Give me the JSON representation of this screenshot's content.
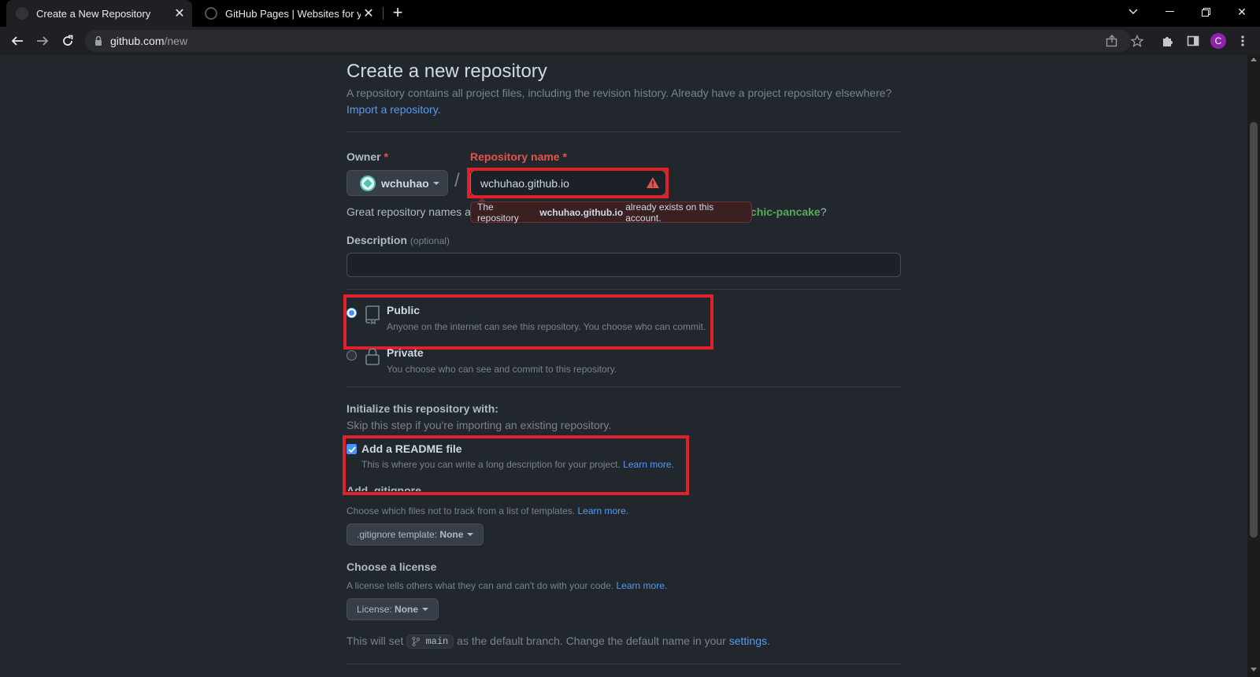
{
  "browser": {
    "tabs": [
      {
        "title": "Create a New Repository",
        "active": true
      },
      {
        "title": "GitHub Pages | Websites for you",
        "active": false
      }
    ],
    "url_host": "github.com",
    "url_path": "/new",
    "profile_initial": "C"
  },
  "page": {
    "title": "Create a new repository",
    "subtitle": "A repository contains all project files, including the revision history. Already have a project repository elsewhere?",
    "import_link": "Import a repository.",
    "owner": {
      "label": "Owner",
      "required": "*",
      "value": "wchuhao"
    },
    "slash": "/",
    "repo_name": {
      "label": "Repository name",
      "required": "*",
      "value": "wchuhao.github.io"
    },
    "hint": {
      "prefix": "Great repository names a",
      "suggestion": "chic-pancake",
      "suffix": "?"
    },
    "error_tooltip": {
      "pre": "The repository",
      "name": "wchuhao.github.io",
      "post": "already exists on this account."
    },
    "description": {
      "label": "Description",
      "optional": "(optional)",
      "value": ""
    },
    "visibility": {
      "public": {
        "title": "Public",
        "desc": "Anyone on the internet can see this repository. You choose who can commit.",
        "selected": true
      },
      "private": {
        "title": "Private",
        "desc": "You choose who can see and commit to this repository.",
        "selected": false
      }
    },
    "init": {
      "title": "Initialize this repository with:",
      "subtitle": "Skip this step if you're importing an existing repository.",
      "readme": {
        "title": "Add a README file",
        "desc": "This is where you can write a long description for your project.",
        "link": "Learn more.",
        "checked": true
      }
    },
    "gitignore": {
      "title": "Add .gitignore",
      "desc": "Choose which files not to track from a list of templates.",
      "link": "Learn more.",
      "button_prefix": ".gitignore template:",
      "button_value": "None"
    },
    "license": {
      "title": "Choose a license",
      "desc": "A license tells others what they can and can't do with your code.",
      "link": "Learn more.",
      "button_prefix": "License:",
      "button_value": "None"
    },
    "branch": {
      "pre": "This will set",
      "name": "main",
      "post": "as the default branch. Change the default name in your",
      "link": "settings",
      "end": "."
    }
  },
  "colors": {
    "background": "#22272e",
    "link": "#539bf5",
    "danger": "#e5534b",
    "annotation": "#e0202a",
    "success": "#57ab5a"
  }
}
